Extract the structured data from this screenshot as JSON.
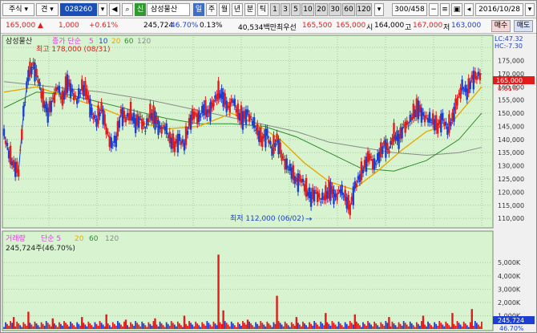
{
  "toolbar": {
    "market": "주식",
    "mode": "견",
    "code": "028260",
    "type_badge": "신",
    "stock_name": "삼성물산",
    "period_btns": [
      "일",
      "주",
      "월",
      "년",
      "분",
      "틱"
    ],
    "minute_btns": [
      "1",
      "3",
      "5",
      "10",
      "20",
      "30",
      "60",
      "120"
    ],
    "count": "300/458",
    "date": "2016/10/28"
  },
  "quote": {
    "price": "165,000",
    "change": "▲",
    "change_value": "1,000",
    "change_pct": "+0.61%",
    "volume": "245,724",
    "vol_ratio": "46.70%",
    "turnover": "0.13%",
    "amount": "40,534백만",
    "pref_label": "최우선",
    "pref_value1": "165,500",
    "pref_value2": "165,000",
    "open_label": "시",
    "open": "164,000",
    "high_label": "고",
    "high": "167,000",
    "low_label": "저",
    "low": "163,000",
    "buy_label": "매수",
    "sell_label": "매도"
  },
  "colors": {
    "panel_bg": "#d8f3cf",
    "grid": "#a9c9a0",
    "up": "#e21b1b",
    "down": "#1c3fd1",
    "ma5": "#e040e0",
    "ma10": "#1c3fd1",
    "ma20": "#e8a800",
    "ma60": "#2e8b2e",
    "ma120": "#8a8a8a",
    "price_tag": "#e21b1b"
  },
  "chart_data": [
    {
      "type": "candlestick",
      "title": "삼성물산",
      "legend": [
        {
          "label": "종가 단순",
          "color": "#e040e0"
        },
        {
          "label": "5",
          "color": "#e040e0"
        },
        {
          "label": "10",
          "color": "#1c3fd1"
        },
        {
          "label": "20",
          "color": "#e8a800"
        },
        {
          "label": "60",
          "color": "#2e8b2e"
        },
        {
          "label": "120",
          "color": "#8a8a8a"
        }
      ],
      "y_ticks": [
        110000,
        115000,
        120000,
        125000,
        130000,
        135000,
        140000,
        145000,
        150000,
        155000,
        160000,
        165000,
        170000,
        175000
      ],
      "y_tick_labels": [
        "110,000",
        "115,000",
        "120,000",
        "125,000",
        "130,000",
        "135,000",
        "140,000",
        "145,000",
        "150,000",
        "155,000",
        "160,000",
        "170,000",
        "175,000"
      ],
      "ylim": [
        107000,
        179000
      ],
      "last_price_tag": "165,000",
      "last_pct_tag": "0.61%",
      "lc": "LC:47.32",
      "hc": "HC:-7.30",
      "annotation_high": "최고 178,000 (08/31)",
      "annotation_low": "최저 112,000 (06/02)",
      "close_path": [
        [
          0,
          142000
        ],
        [
          6,
          135000
        ],
        [
          12,
          130000
        ],
        [
          18,
          128000
        ],
        [
          24,
          150000
        ],
        [
          30,
          165000
        ],
        [
          36,
          168000
        ],
        [
          42,
          163000
        ],
        [
          48,
          155000
        ],
        [
          54,
          150000
        ],
        [
          60,
          155000
        ],
        [
          66,
          160000
        ],
        [
          72,
          155000
        ],
        [
          78,
          162000
        ],
        [
          84,
          158000
        ],
        [
          90,
          155000
        ],
        [
          96,
          160000
        ],
        [
          102,
          158000
        ],
        [
          108,
          150000
        ],
        [
          114,
          147000
        ],
        [
          120,
          152000
        ],
        [
          126,
          144000
        ],
        [
          132,
          138000
        ],
        [
          138,
          140000
        ],
        [
          144,
          150000
        ],
        [
          150,
          148000
        ],
        [
          156,
          150000
        ],
        [
          162,
          146000
        ],
        [
          168,
          148000
        ],
        [
          174,
          144000
        ],
        [
          180,
          150000
        ],
        [
          186,
          148000
        ],
        [
          192,
          144000
        ],
        [
          198,
          145000
        ],
        [
          204,
          140000
        ],
        [
          210,
          138000
        ],
        [
          216,
          140000
        ],
        [
          222,
          138000
        ],
        [
          228,
          146000
        ],
        [
          234,
          150000
        ],
        [
          240,
          148000
        ],
        [
          246,
          152000
        ],
        [
          252,
          150000
        ],
        [
          258,
          154000
        ],
        [
          264,
          158000
        ],
        [
          270,
          156000
        ],
        [
          276,
          152000
        ],
        [
          282,
          155000
        ],
        [
          288,
          150000
        ],
        [
          294,
          148000
        ],
        [
          300,
          150000
        ],
        [
          306,
          147000
        ],
        [
          312,
          143000
        ],
        [
          318,
          140000
        ],
        [
          324,
          142000
        ],
        [
          330,
          136000
        ],
        [
          336,
          140000
        ],
        [
          342,
          134000
        ],
        [
          348,
          130000
        ],
        [
          354,
          128000
        ],
        [
          360,
          124000
        ],
        [
          366,
          125000
        ],
        [
          372,
          121000
        ],
        [
          378,
          118000
        ],
        [
          384,
          120000
        ],
        [
          390,
          117000
        ],
        [
          396,
          119000
        ],
        [
          402,
          121000
        ],
        [
          408,
          118000
        ],
        [
          414,
          121000
        ],
        [
          420,
          118000
        ],
        [
          426,
          114000
        ],
        [
          432,
          122000
        ],
        [
          438,
          126000
        ],
        [
          444,
          130000
        ],
        [
          450,
          134000
        ],
        [
          456,
          130000
        ],
        [
          462,
          134000
        ],
        [
          468,
          138000
        ],
        [
          474,
          136000
        ],
        [
          480,
          142000
        ],
        [
          486,
          140000
        ],
        [
          492,
          145000
        ],
        [
          498,
          146000
        ],
        [
          504,
          150000
        ],
        [
          510,
          152000
        ],
        [
          516,
          149000
        ],
        [
          522,
          148000
        ],
        [
          528,
          147000
        ],
        [
          534,
          145000
        ],
        [
          540,
          148000
        ],
        [
          546,
          144000
        ],
        [
          552,
          148000
        ],
        [
          558,
          155000
        ],
        [
          564,
          160000
        ],
        [
          570,
          158000
        ],
        [
          576,
          163000
        ],
        [
          582,
          164000
        ],
        [
          588,
          165000
        ]
      ],
      "ma20": [
        [
          0,
          158000
        ],
        [
          40,
          160000
        ],
        [
          80,
          156000
        ],
        [
          120,
          152000
        ],
        [
          160,
          147000
        ],
        [
          200,
          144000
        ],
        [
          240,
          145000
        ],
        [
          280,
          150000
        ],
        [
          310,
          146000
        ],
        [
          340,
          140000
        ],
        [
          370,
          131000
        ],
        [
          400,
          124000
        ],
        [
          430,
          121000
        ],
        [
          460,
          128000
        ],
        [
          490,
          136000
        ],
        [
          520,
          143000
        ],
        [
          550,
          146000
        ],
        [
          588,
          160000
        ]
      ],
      "ma60": [
        [
          0,
          152000
        ],
        [
          40,
          158000
        ],
        [
          80,
          157000
        ],
        [
          120,
          154000
        ],
        [
          160,
          151000
        ],
        [
          200,
          148000
        ],
        [
          240,
          146000
        ],
        [
          280,
          146000
        ],
        [
          320,
          145000
        ],
        [
          360,
          141000
        ],
        [
          400,
          135000
        ],
        [
          440,
          129000
        ],
        [
          480,
          128000
        ],
        [
          520,
          132000
        ],
        [
          560,
          140000
        ],
        [
          588,
          150000
        ]
      ],
      "ma120": [
        [
          0,
          162000
        ],
        [
          60,
          160000
        ],
        [
          120,
          158000
        ],
        [
          180,
          155000
        ],
        [
          240,
          151000
        ],
        [
          300,
          147000
        ],
        [
          360,
          143000
        ],
        [
          400,
          139000
        ],
        [
          440,
          137000
        ],
        [
          480,
          135000
        ],
        [
          520,
          134000
        ],
        [
          560,
          135000
        ],
        [
          588,
          137000
        ]
      ]
    },
    {
      "type": "bar",
      "title": "거래량",
      "legend": [
        {
          "label": "거래량",
          "color": "#e040e0"
        },
        {
          "label": "단순 5",
          "color": "#e040e0"
        },
        {
          "label": "20",
          "color": "#e8a800"
        },
        {
          "label": "60",
          "color": "#2e8b2e"
        },
        {
          "label": "120",
          "color": "#8a8a8a"
        }
      ],
      "readout": "245,724주(46.70%)",
      "y_ticks": [
        1000000,
        2000000,
        3000000,
        4000000,
        5000000
      ],
      "y_tick_labels": [
        "1,000K",
        "2,000K",
        "3,000K",
        "4,000K",
        "5,000K"
      ],
      "ylim": [
        0,
        5800000
      ],
      "last_volume_tag": "245,724",
      "last_pct_tag": "46.70%",
      "spikes": [
        {
          "x": 12,
          "v": 900000
        },
        {
          "x": 30,
          "v": 1300000
        },
        {
          "x": 60,
          "v": 800000
        },
        {
          "x": 96,
          "v": 900000
        },
        {
          "x": 126,
          "v": 1100000
        },
        {
          "x": 150,
          "v": 700000
        },
        {
          "x": 186,
          "v": 800000
        },
        {
          "x": 222,
          "v": 1000000
        },
        {
          "x": 264,
          "v": 5600000
        },
        {
          "x": 270,
          "v": 1400000
        },
        {
          "x": 300,
          "v": 700000
        },
        {
          "x": 336,
          "v": 2500000
        },
        {
          "x": 360,
          "v": 900000
        },
        {
          "x": 396,
          "v": 1200000
        },
        {
          "x": 432,
          "v": 1100000
        },
        {
          "x": 474,
          "v": 900000
        },
        {
          "x": 516,
          "v": 1000000
        },
        {
          "x": 552,
          "v": 1200000
        },
        {
          "x": 576,
          "v": 1500000
        }
      ]
    }
  ]
}
